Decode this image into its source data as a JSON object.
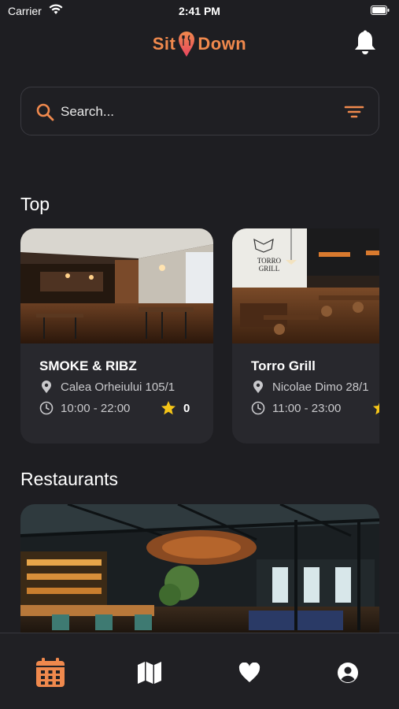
{
  "status_bar": {
    "carrier": "Carrier",
    "time": "2:41 PM"
  },
  "header": {
    "logo_left": "Sit",
    "logo_right": "Down"
  },
  "search": {
    "placeholder": "Search..."
  },
  "sections": {
    "top_title": "Top",
    "restaurants_title": "Restaurants"
  },
  "top_cards": [
    {
      "name": "SMOKE & RIBZ",
      "address": "Calea Orheiului 105/1",
      "hours": "10:00 - 22:00",
      "rating": "0"
    },
    {
      "name": "Torro Grill",
      "address": "Nicolae Dimo 28/1",
      "hours": "11:00 - 23:00",
      "rating": ""
    }
  ],
  "torro_sign": {
    "line1": "TORRO",
    "line2": "GRILL"
  },
  "tab_bar": {
    "active_tab": "calendar",
    "tabs": [
      "calendar",
      "map",
      "favorites",
      "profile"
    ]
  },
  "colors": {
    "background": "#1e1e22",
    "card": "#28282d",
    "accent": "#f0894d",
    "star": "#f5c518",
    "logo_pin": "#e8455f"
  },
  "icons": [
    "wifi-icon",
    "battery-icon",
    "pin-logo-icon",
    "bell-icon",
    "search-icon",
    "filter-icon",
    "location-icon",
    "clock-icon",
    "star-icon",
    "calendar-icon",
    "map-icon",
    "heart-icon",
    "profile-icon"
  ]
}
